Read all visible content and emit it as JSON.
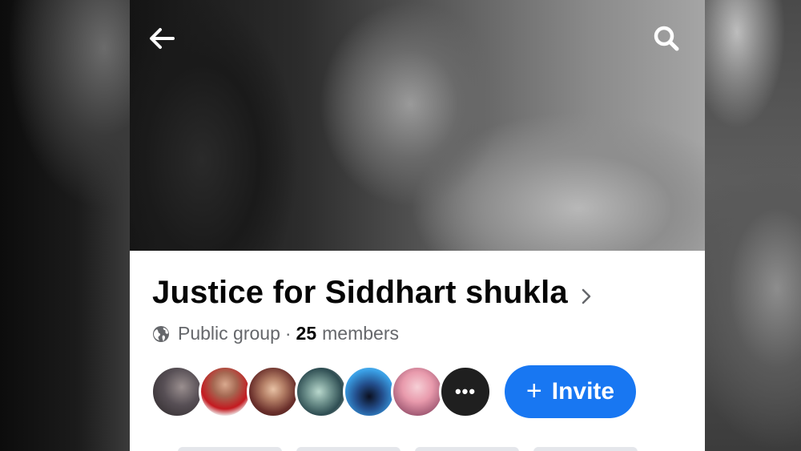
{
  "header": {
    "back_icon": "arrow-left-icon",
    "search_icon": "search-icon"
  },
  "group": {
    "name": "Justice for Siddhart shukla",
    "privacy_label": "Public group",
    "separator": "·",
    "member_count": "25",
    "members_label": "members"
  },
  "members": {
    "more_label": "•••"
  },
  "actions": {
    "invite_plus": "+",
    "invite_label": "Invite"
  },
  "colors": {
    "brand_blue": "#1877f2",
    "title_text": "#050505",
    "secondary_text": "#65676b"
  }
}
